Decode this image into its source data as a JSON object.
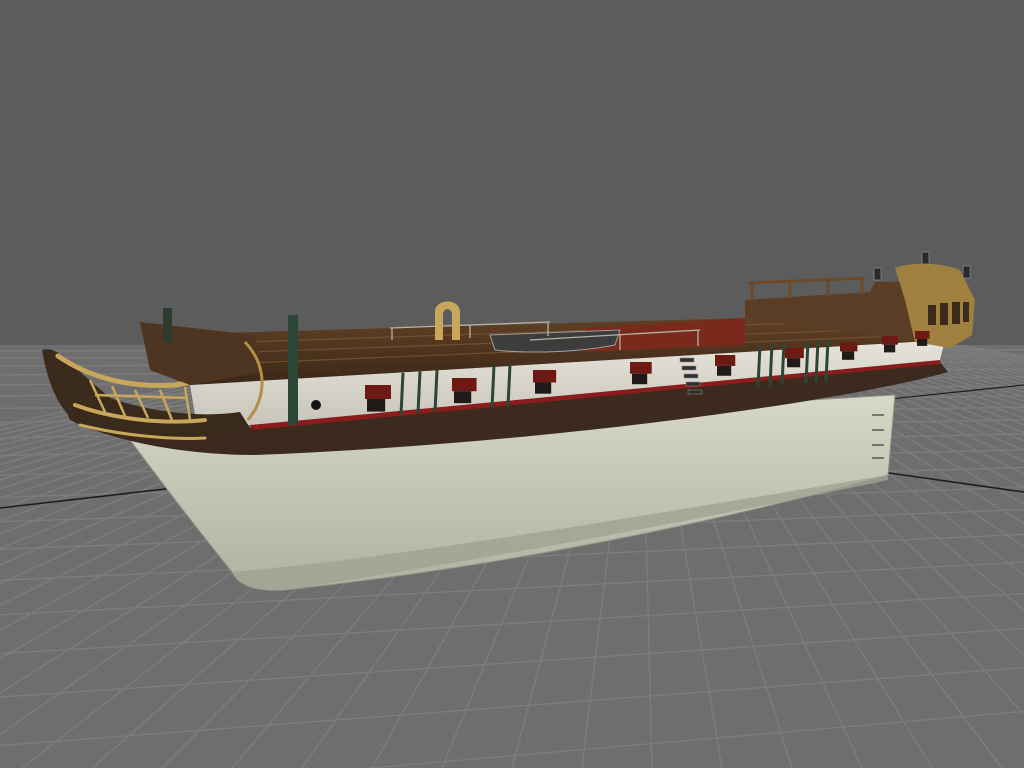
{
  "viewport": {
    "background_color": "#5c5c5c",
    "grid_color": "#7c7c7c",
    "grid_bg_color": "#6e6e6e",
    "axis_color": "#1c1c1c",
    "grid_visible": true
  },
  "model": {
    "type": "sailing-ship-hull",
    "colors": {
      "lower_hull": "#bcbfae",
      "lower_hull_shadow": "#9fa393",
      "upper_hull": "#dcdad2",
      "wale": "#3c2b1e",
      "red_stripe": "#8a1c1c",
      "deck_wood": "#4a3220",
      "deck_light": "#6b4a2c",
      "gilding": "#c9a75a",
      "gunport": "#6e1a14",
      "cannon": "#1e1b19",
      "stern_wood": "#a0803f",
      "rigging": "#2b4536"
    }
  }
}
